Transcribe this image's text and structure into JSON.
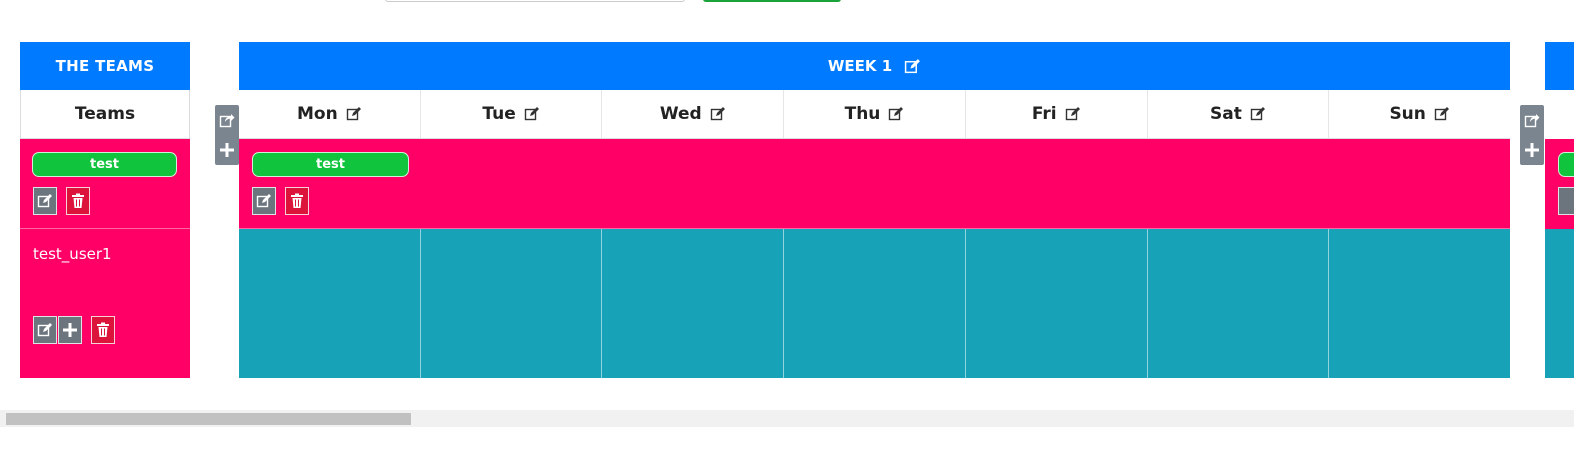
{
  "teams_panel": {
    "title": "THE TEAMS",
    "column_header": "Teams",
    "team": {
      "name": "test"
    },
    "user": {
      "name": "test_user1"
    }
  },
  "week_panel": {
    "title": "WEEK 1",
    "days": [
      "Mon",
      "Tue",
      "Wed",
      "Thu",
      "Fri",
      "Sat",
      "Sun"
    ],
    "team": {
      "name": "test"
    }
  },
  "next_panel": {
    "team": {
      "name": ""
    }
  },
  "colors": {
    "header_blue": "#007bff",
    "team_row_pink": "#ff0066",
    "schedule_teal": "#17a2b8",
    "pill_green": "#11c43d",
    "delete_red": "#dc143c",
    "action_gray": "#6c757d"
  },
  "icons": {
    "edit": "edit-icon",
    "delete": "trash-icon",
    "add": "plus-icon",
    "share": "share-icon"
  }
}
